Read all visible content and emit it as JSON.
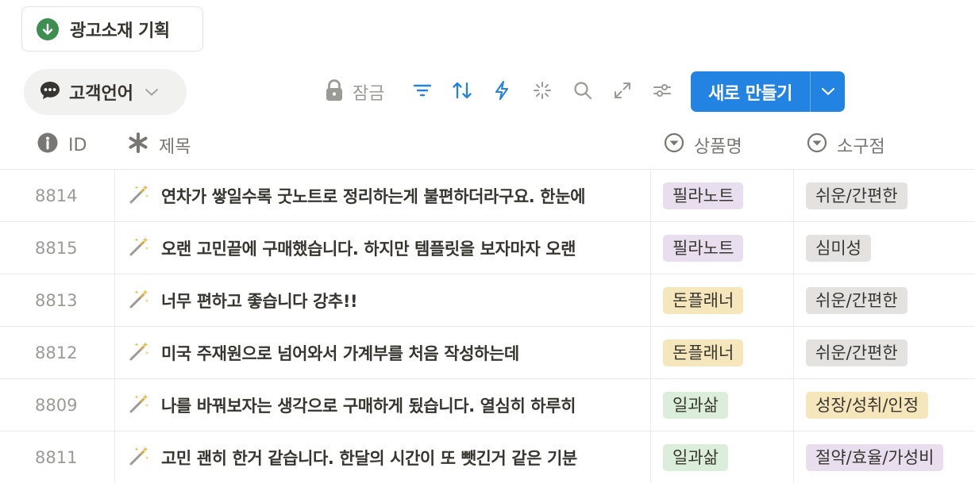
{
  "top_button": {
    "label": "광고소재 기획",
    "icon": "download-circle-icon",
    "color": "#3e8e52"
  },
  "view_tab": {
    "label": "고객언어",
    "icon": "speech-bubble-icon"
  },
  "toolbar": {
    "lock_label": "잠금",
    "new_label": "새로 만들기",
    "accent": "#2383e2"
  },
  "columns": {
    "id": "ID",
    "title": "제목",
    "product": "상품명",
    "appeal": "소구점"
  },
  "tag_colors": {
    "필라노트": "#e8deee",
    "돈플래너": "#f5e6bb",
    "일과삶": "#dbeddb",
    "쉬운/간편한": "#e3e2e0",
    "심미성": "#e3e2e0",
    "성장/성취/인정": "#f5e6bb",
    "절약/효율/가성비": "#e8deee"
  },
  "rows": [
    {
      "id": "8814",
      "title": "연차가 쌓일수록 굿노트로 정리하는게 불편하더라구요. 한눈에",
      "product": "필라노트",
      "appeal": "쉬운/간편한"
    },
    {
      "id": "8815",
      "title": "오랜 고민끝에 구매했습니다. 하지만 템플릿을 보자마자 오랜",
      "product": "필라노트",
      "appeal": "심미성"
    },
    {
      "id": "8813",
      "title": "너무 편하고 좋습니다 강추!!",
      "product": "돈플래너",
      "appeal": "쉬운/간편한"
    },
    {
      "id": "8812",
      "title": "미국 주재원으로 넘어와서 가계부를 처음 작성하는데",
      "product": "돈플래너",
      "appeal": "쉬운/간편한"
    },
    {
      "id": "8809",
      "title": "나를 바꿔보자는 생각으로 구매하게 됬습니다. 열심히 하루히",
      "product": "일과삶",
      "appeal": "성장/성취/인정"
    },
    {
      "id": "8811",
      "title": "고민 괜히 한거 같습니다. 한달의 시간이 또 뺏긴거 같은 기분",
      "product": "일과삶",
      "appeal": "절약/효율/가성비"
    }
  ]
}
